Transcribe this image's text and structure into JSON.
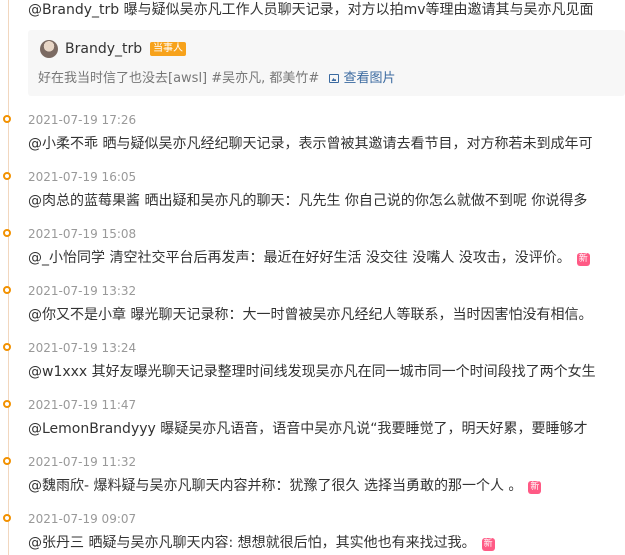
{
  "top_entry": {
    "text": "@Brandy_trb 曝与疑似吴亦凡工作人员聊天记录，对方以拍mv等理由邀请其与吴亦凡见面"
  },
  "quote_card": {
    "username": "Brandy_trb",
    "badge": "当事人",
    "text": "好在我当时信了也没去[awsl] #吴亦凡, 都美竹#",
    "image_link": "查看图片"
  },
  "entries": [
    {
      "date": "2021-07-19 17:26",
      "text": "@小柔不乖 晒与疑似吴亦凡经纪聊天记录，表示曾被其邀请去看节目，对方称若未到成年可",
      "new": false
    },
    {
      "date": "2021-07-19 16:05",
      "text": "@肉总的蓝莓果酱 晒出疑和吴亦凡的聊天：凡先生 你自己说的你怎么就做不到呢 你说得多",
      "new": false
    },
    {
      "date": "2021-07-19 15:08",
      "text": "@_小怡同学 清空社交平台后再发声：最近在好好生活 没交往 没嘴人 没攻击，没评价。",
      "new": true
    },
    {
      "date": "2021-07-19 13:32",
      "text": "@你又不是小章 曝光聊天记录称：大一时曾被吴亦凡经纪人等联系，当时因害怕没有相信。",
      "new": false
    },
    {
      "date": "2021-07-19 13:24",
      "text": "@w1xxx 其好友曝光聊天记录整理时间线发现吴亦凡在同一城市同一个时间段找了两个女生",
      "new": false
    },
    {
      "date": "2021-07-19 11:47",
      "text": "@LemonBrandyyy 曝疑吴亦凡语音，语音中吴亦凡说“我要睡觉了，明天好累，要睡够才",
      "new": false
    },
    {
      "date": "2021-07-19 11:32",
      "text": "@魏雨欣- 爆料疑与吴亦凡聊天内容并称：犹豫了很久 选择当勇敢的那一个人 。",
      "new": true
    },
    {
      "date": "2021-07-19 09:07",
      "text": "@张丹三 晒疑与吴亦凡聊天内容: 想想就很后怕，其实他也有来找过我。",
      "new": true
    }
  ],
  "new_badge_label": "新",
  "colors": {
    "accent": "#f29100",
    "new_badge": "#ff5a85",
    "party_badge": "#f7a21b",
    "link": "#3b6aa0"
  }
}
